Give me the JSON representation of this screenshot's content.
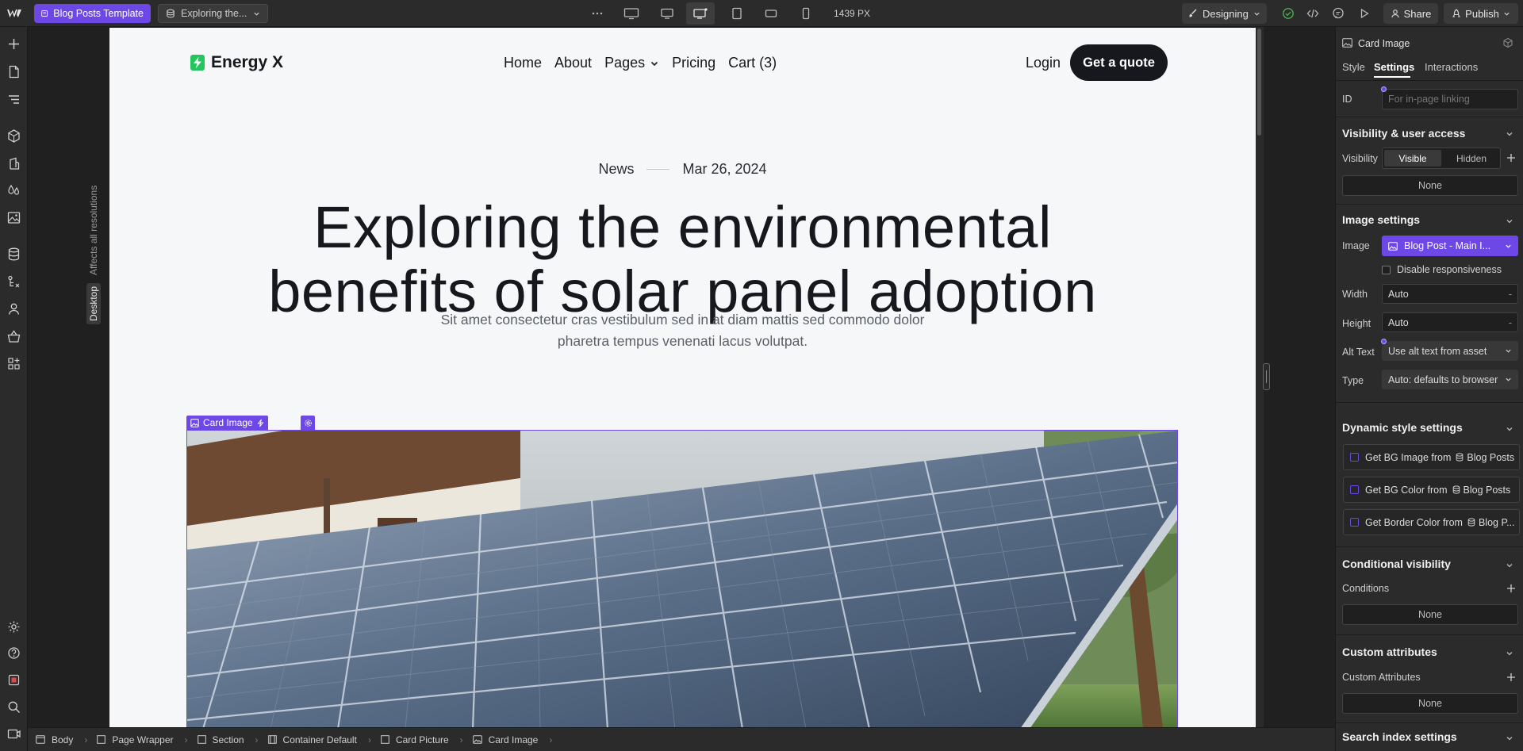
{
  "topbar": {
    "page_name": "Blog Posts Template",
    "cms_collection": "Exploring the...",
    "breakpoint_width": "1439 PX",
    "mode": "Designing",
    "share_label": "Share",
    "publish_label": "Publish"
  },
  "canvas": {
    "affects_label": "Affects all resolutions",
    "breakpoint_tag": "Desktop"
  },
  "site": {
    "brand": "Energy X",
    "nav": [
      "Home",
      "About",
      "Pages",
      "Pricing",
      "Cart (3)"
    ],
    "login": "Login",
    "cta": "Get a quote",
    "post_category": "News",
    "post_date": "Mar 26, 2024",
    "post_title_line1": "Exploring the environmental",
    "post_title_line2": "benefits of solar panel adoption",
    "post_summary": "Sit amet consectetur cras vestibulum sed in at diam mattis sed commodo dolor pharetra tempus venenati lacus volutpat.",
    "selected_element": "Card Image"
  },
  "breadcrumb": [
    "Body",
    "Page Wrapper",
    "Section",
    "Container Default",
    "Card Picture",
    "Card Image"
  ],
  "panel": {
    "element_name": "Card Image",
    "tabs": [
      "Style",
      "Settings",
      "Interactions"
    ],
    "id_label": "ID",
    "id_placeholder": "For in-page linking",
    "visibility_section": "Visibility & user access",
    "visibility_label": "Visibility",
    "visibility_options": [
      "Visible",
      "Hidden"
    ],
    "visibility_none": "None",
    "image_section": "Image settings",
    "image_label": "Image",
    "image_value": "Blog Post - Main I...",
    "disable_responsiveness": "Disable responsiveness",
    "width_label": "Width",
    "width_value": "Auto",
    "height_label": "Height",
    "height_value": "Auto",
    "alt_label": "Alt Text",
    "alt_value": "Use alt text from asset",
    "type_label": "Type",
    "type_value": "Auto: defaults to browser",
    "dynamic_section": "Dynamic style settings",
    "dynamic_rows": [
      {
        "label": "Get BG Image from",
        "source": "Blog Posts"
      },
      {
        "label": "Get BG Color from",
        "source": "Blog Posts"
      },
      {
        "label": "Get Border Color from",
        "source": "Blog P..."
      }
    ],
    "conditional_section": "Conditional visibility",
    "conditions_label": "Conditions",
    "conditions_none": "None",
    "custom_attr_section": "Custom attributes",
    "custom_attr_label": "Custom Attributes",
    "custom_attr_none": "None",
    "search_section": "Search index settings"
  },
  "colors": {
    "accent": "#6e48e6",
    "brand_green": "#22c55e",
    "site_dark": "#16181d"
  }
}
